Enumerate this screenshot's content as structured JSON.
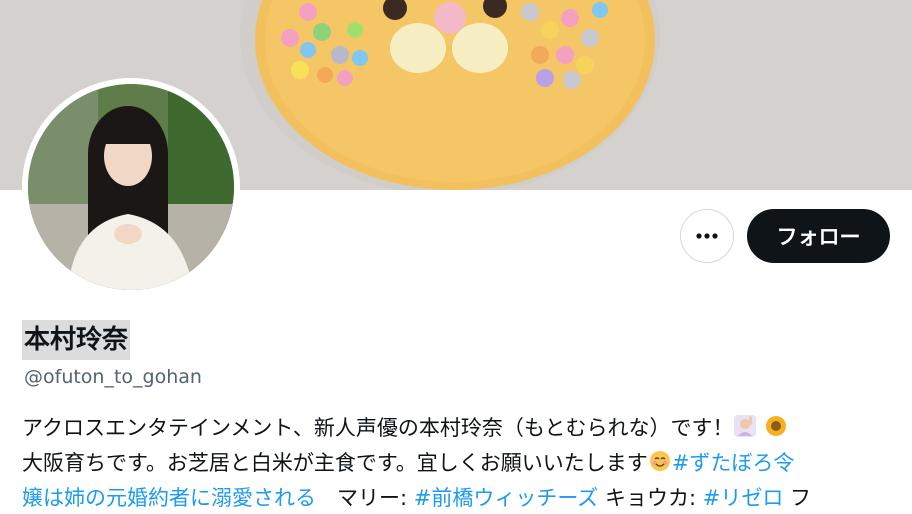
{
  "profile": {
    "display_name": "本村玲奈",
    "handle": "@ofuton_to_gohan",
    "follow_label": "フォロー",
    "more_icon": "more-dots-icon"
  },
  "bio": {
    "line1": "アクロスエンタテインメント、新人声優の本村玲奈（もとむられな）です！",
    "line2_text": "大阪育ちです。お芝居と白米が主食です。宜しくお願いいたします",
    "line2_tag": "#ずたぼろ令",
    "line3_tag1": "嬢は姉の元婚約者に溺愛される",
    "line3_text1": "　マリー: ",
    "line3_tag2": "#前橋ウィッチーズ",
    "line3_text2": " キョウカ: ",
    "line3_tag3": "#リゼロ",
    "line3_text3": " フ"
  },
  "colors": {
    "link": "#1d9bf0",
    "text": "#0f1419",
    "muted": "#536471",
    "button_bg": "#0f1419"
  }
}
